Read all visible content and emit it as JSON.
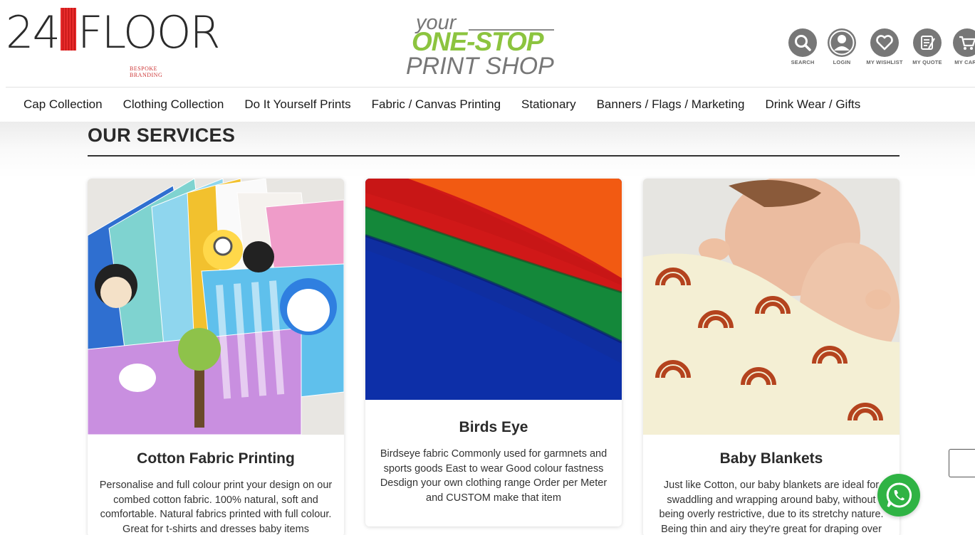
{
  "header": {
    "logo": {
      "main_left": "24",
      "main_right": "FLOOR",
      "tagline": "BESPOKE BRANDING"
    },
    "slogan": {
      "line1": "your",
      "line2": "ONE-STOP",
      "line3": "PRINT SHOP"
    },
    "icons": [
      {
        "name": "search-icon",
        "label": "SEARCH"
      },
      {
        "name": "login-icon",
        "label": "LOGIN"
      },
      {
        "name": "heart-icon",
        "label": "MY WISHLIST"
      },
      {
        "name": "quote-icon",
        "label": "MY QUOTE"
      },
      {
        "name": "cart-icon",
        "label": "MY CART"
      }
    ]
  },
  "nav": {
    "items": [
      "Cap Collection",
      "Clothing Collection",
      "Do It Yourself Prints",
      "Fabric / Canvas Printing",
      "Stationary",
      "Banners / Flags / Marketing",
      "Drink Wear / Gifts"
    ]
  },
  "services": {
    "title": "OUR SERVICES",
    "cards": [
      {
        "title": "Cotton Fabric Printing",
        "text": "Personalise and full colour print your design on our combed cotton fabric. 100% natural, soft and comfortable. Natural fabrics printed with full colour. Great for t-shirts and dresses baby items"
      },
      {
        "title": "Birds Eye",
        "text": "Birdseye fabric Commonly used for garmnets and sports goods East to wear Good colour fastness Desdign your own clothing range Order per Meter and CUSTOM make that item"
      },
      {
        "title": "Baby Blankets",
        "text": "Just like Cotton, our baby blankets are ideal for swaddling and wrapping around baby, without being overly restrictive, due to its stretchy nature. Being thin and airy they're great for draping over"
      }
    ]
  },
  "colors": {
    "slogan_green": "#8cc43f",
    "logo_red": "#e52a2a",
    "whatsapp_green": "#2fb344",
    "icon_grey": "#777777"
  }
}
